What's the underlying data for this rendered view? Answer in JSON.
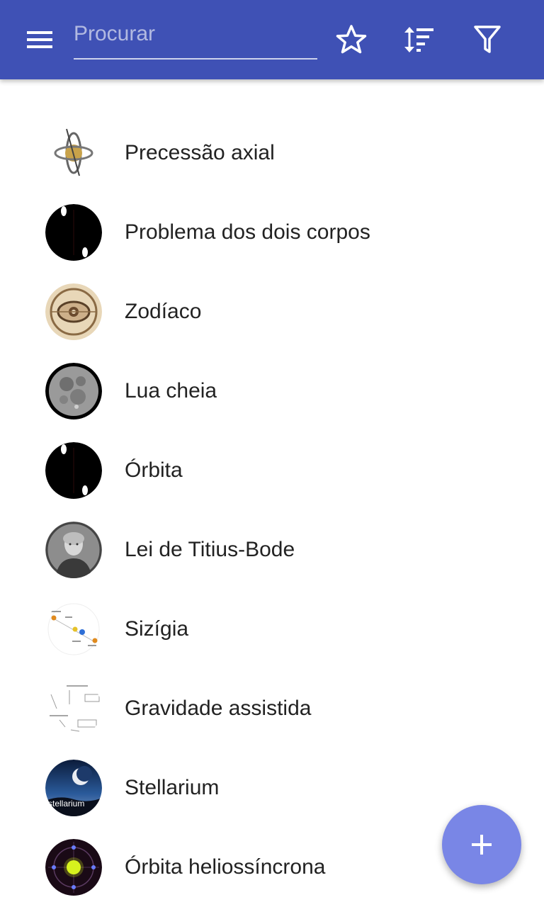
{
  "header": {
    "search_placeholder": "Procurar",
    "search_value": "",
    "icons": {
      "menu": "menu-icon",
      "favorite": "star-outline-icon",
      "sort": "sort-icon",
      "filter": "filter-icon"
    },
    "color": "#3f51b5"
  },
  "list": {
    "items": [
      {
        "label": "Precessão axial",
        "icon": "axial-precession-thumb"
      },
      {
        "label": "Problema dos dois corpos",
        "icon": "two-body-thumb"
      },
      {
        "label": "Zodíaco",
        "icon": "zodiac-thumb"
      },
      {
        "label": "Lua cheia",
        "icon": "full-moon-thumb"
      },
      {
        "label": "Órbita",
        "icon": "orbit-thumb"
      },
      {
        "label": "Lei de Titius-Bode",
        "icon": "portrait-thumb"
      },
      {
        "label": "Sizígia",
        "icon": "syzygy-diagram-thumb"
      },
      {
        "label": "Gravidade assistida",
        "icon": "gravity-assist-diagram-thumb"
      },
      {
        "label": "Stellarium",
        "icon": "stellarium-thumb",
        "thumb_text": "stellarium"
      },
      {
        "label": "Órbita heliossíncrona",
        "icon": "sun-synchronous-orbit-thumb"
      }
    ]
  },
  "fab": {
    "icon": "plus-icon",
    "color": "#7986e6"
  }
}
